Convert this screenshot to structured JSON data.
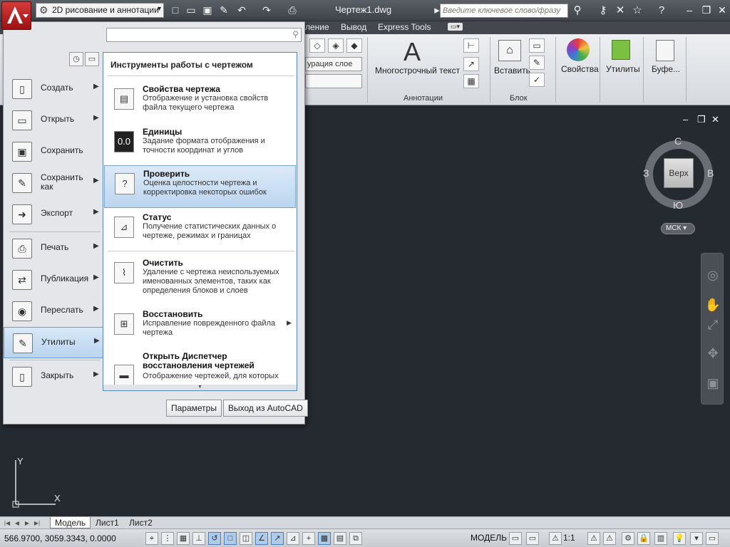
{
  "titlebar": {
    "workspace": "2D рисование и аннотации",
    "document_title": "Чертеж1.dwg",
    "search_placeholder": "Введите ключевое слово/фразу",
    "help_label": "?"
  },
  "ribbon": {
    "tabs": [
      "ление",
      "Вывод",
      "Express Tools"
    ],
    "layer_combo_value": "урация слое",
    "panels": {
      "annotations": "Аннотации",
      "block": "Блок"
    },
    "buttons": {
      "mtext": "Многострочный текст",
      "insert": "Вставить",
      "properties": "Свойства",
      "utilities": "Утилиты",
      "clipboard": "Буфе..."
    }
  },
  "viewcube": {
    "face": "Верх",
    "north": "С",
    "south": "Ю",
    "west": "З",
    "east": "В",
    "wcs": "МСК"
  },
  "ucs": {
    "x": "X",
    "y": "Y"
  },
  "layout_tabs": [
    "Модель",
    "Лист1",
    "Лист2"
  ],
  "status": {
    "coordinates": "566.9700,  3059.3343, 0.0000",
    "model": "МОДЕЛЬ",
    "scale": "1:1"
  },
  "app_menu": {
    "left_items": [
      {
        "label": "Создать",
        "icon": "new-icon"
      },
      {
        "label": "Открыть",
        "icon": "open-icon"
      },
      {
        "label": "Сохранить",
        "icon": "save-icon"
      },
      {
        "label": "Сохранить как",
        "icon": "saveas-icon"
      },
      {
        "label": "Экспорт",
        "icon": "export-icon"
      },
      {
        "label": "Печать",
        "icon": "print-icon"
      },
      {
        "label": "Публикация",
        "icon": "publish-icon"
      },
      {
        "label": "Переслать",
        "icon": "send-icon"
      },
      {
        "label": "Утилиты",
        "icon": "utilities-icon"
      },
      {
        "label": "Закрыть",
        "icon": "close-icon"
      }
    ],
    "panel_title": "Инструменты работы с чертежом",
    "right_items": [
      {
        "title": "Свойства чертежа",
        "desc": "Отображение и установка свойств файла текущего чертежа"
      },
      {
        "title": "Единицы",
        "desc": "Задание формата отображения и точности координат и углов",
        "icon_text": "0.0"
      },
      {
        "title": "Проверить",
        "desc": "Оценка целостности чертежа и корректировка некоторых ошибок",
        "icon_text": "?"
      },
      {
        "title": "Статус",
        "desc": "Получение статистических данных о чертеже, режимах и границах"
      },
      {
        "title": "Очистить",
        "desc": "Удаление с чертежа неиспользуемых именованных элементов, таких как определения блоков и слоев"
      },
      {
        "title": "Восстановить",
        "desc": "Исправление поврежденного файла чертежа"
      },
      {
        "title": "Открыть Диспетчер восстановления чертежей",
        "desc": "Отображение чертежей, для которых"
      }
    ],
    "options_button": "Параметры",
    "exit_button": "Выход из AutoCAD"
  }
}
